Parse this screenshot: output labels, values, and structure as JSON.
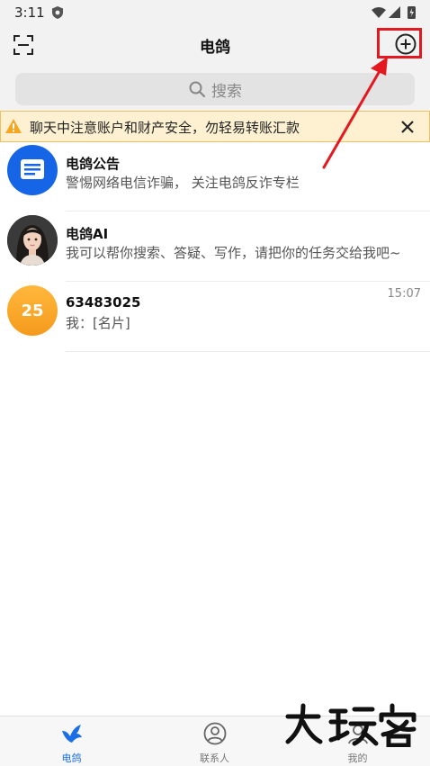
{
  "status_bar": {
    "time": "3:11"
  },
  "header": {
    "title": "电鸽"
  },
  "search": {
    "placeholder": "搜索"
  },
  "warning": {
    "text": "聊天中注意账户和财产安全，勿轻易转账汇款"
  },
  "chats": [
    {
      "name": "电鸽公告",
      "preview": "警惕网络电信诈骗， 关注电鸽反诈专栏",
      "time": ""
    },
    {
      "name": "电鸽AI",
      "preview": "我可以帮你搜索、答疑、写作，请把你的任务交给我吧~",
      "time": ""
    },
    {
      "name": "63483025",
      "preview": "我：[名片]",
      "time": "15:07",
      "avatar_text": "25"
    }
  ],
  "tabs": [
    {
      "label": "电鸽",
      "active": true
    },
    {
      "label": "联系人",
      "active": false
    },
    {
      "label": "我的",
      "active": false
    }
  ],
  "colors": {
    "accent": "#1a6fe6",
    "highlight": "#e3191f",
    "warning_bg": "#fdf1d2"
  },
  "icons": [
    "scan-icon",
    "add-circle-icon",
    "search-icon",
    "warning-icon",
    "close-icon",
    "notice-icon",
    "pigeon-icon",
    "contact-icon",
    "profile-icon"
  ],
  "watermark": "大玩客"
}
